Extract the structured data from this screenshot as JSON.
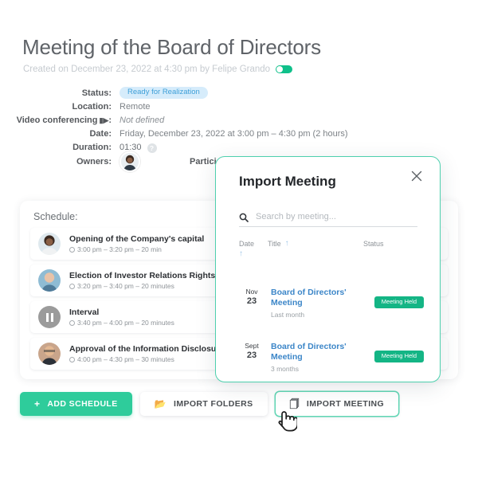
{
  "header": {
    "title": "Meeting of the Board of Directors",
    "created": "Created on December 23, 2022 at 4:30 pm by Felipe Grando",
    "toggle_state": "on"
  },
  "details": {
    "rows": [
      {
        "label": "Status:",
        "value": "Ready for Realization",
        "kind": "badge"
      },
      {
        "label": "Location:",
        "value": "Remote",
        "kind": "text"
      },
      {
        "label": "Video conferencing",
        "value": "Not defined",
        "kind": "italic"
      },
      {
        "label": "Date:",
        "value": "Friday, December 23, 2022 at 3:00 pm – 4:30 pm (2 hours)",
        "kind": "text"
      },
      {
        "label": "Duration:",
        "value": "01:30",
        "kind": "duration"
      }
    ],
    "info_glyph": "?"
  },
  "people": {
    "owners_label": "Owners:",
    "participants_label": "Partici"
  },
  "schedule": {
    "title": "Schedule:",
    "items": [
      {
        "name": "Opening of the Company's capital",
        "time": "3:00 pm  – 3:20 pm – 20 min",
        "avatar": "woman"
      },
      {
        "name": "Election of Investor Relations Rights",
        "time": "3:20 pm  – 3:40 pm – 20 minutes",
        "avatar": "man-bald"
      },
      {
        "name": "Interval",
        "time": "3:40 pm  – 4:00 pm – 20 minutes",
        "avatar": "pause"
      },
      {
        "name": "Approval of the Information Disclosure Pol",
        "time": "4:00 pm  – 4:30 pm – 30 minutes",
        "avatar": "man-glasses"
      }
    ]
  },
  "buttons": [
    {
      "label": "ADD SCHEDULE",
      "icon": "plus-icon",
      "style": "primary"
    },
    {
      "label": "IMPORT FOLDERS",
      "icon": "folder-icon",
      "style": "white"
    },
    {
      "label": "IMPORT MEETING",
      "icon": "copy-icon",
      "style": "white-focused"
    }
  ],
  "modal": {
    "title": "Import Meeting",
    "close_label": "×",
    "search_placeholder": "Search by meeting...",
    "columns": {
      "date": "Date",
      "title": "Title",
      "status": "Status"
    },
    "sort_glyph": "↑",
    "rows": [
      {
        "month": "Nov",
        "day": "23",
        "title_line1": "Board of Directors'",
        "title_line2": "Meeting",
        "subtitle": "Last month",
        "status": "Meeting Held"
      },
      {
        "month": "Sept",
        "day": "23",
        "title_line1": "Board of Directors'",
        "title_line2": "Meeting",
        "subtitle": "3 months",
        "status": "Meeting Held"
      }
    ]
  },
  "colors": {
    "accent_green": "#2ecc9b",
    "badge_green": "#14b585",
    "status_blue_bg": "#d6ecfb",
    "status_blue_text": "#3e9fd8",
    "link_blue": "#3c86c8",
    "modal_border": "#4ed0ae"
  }
}
